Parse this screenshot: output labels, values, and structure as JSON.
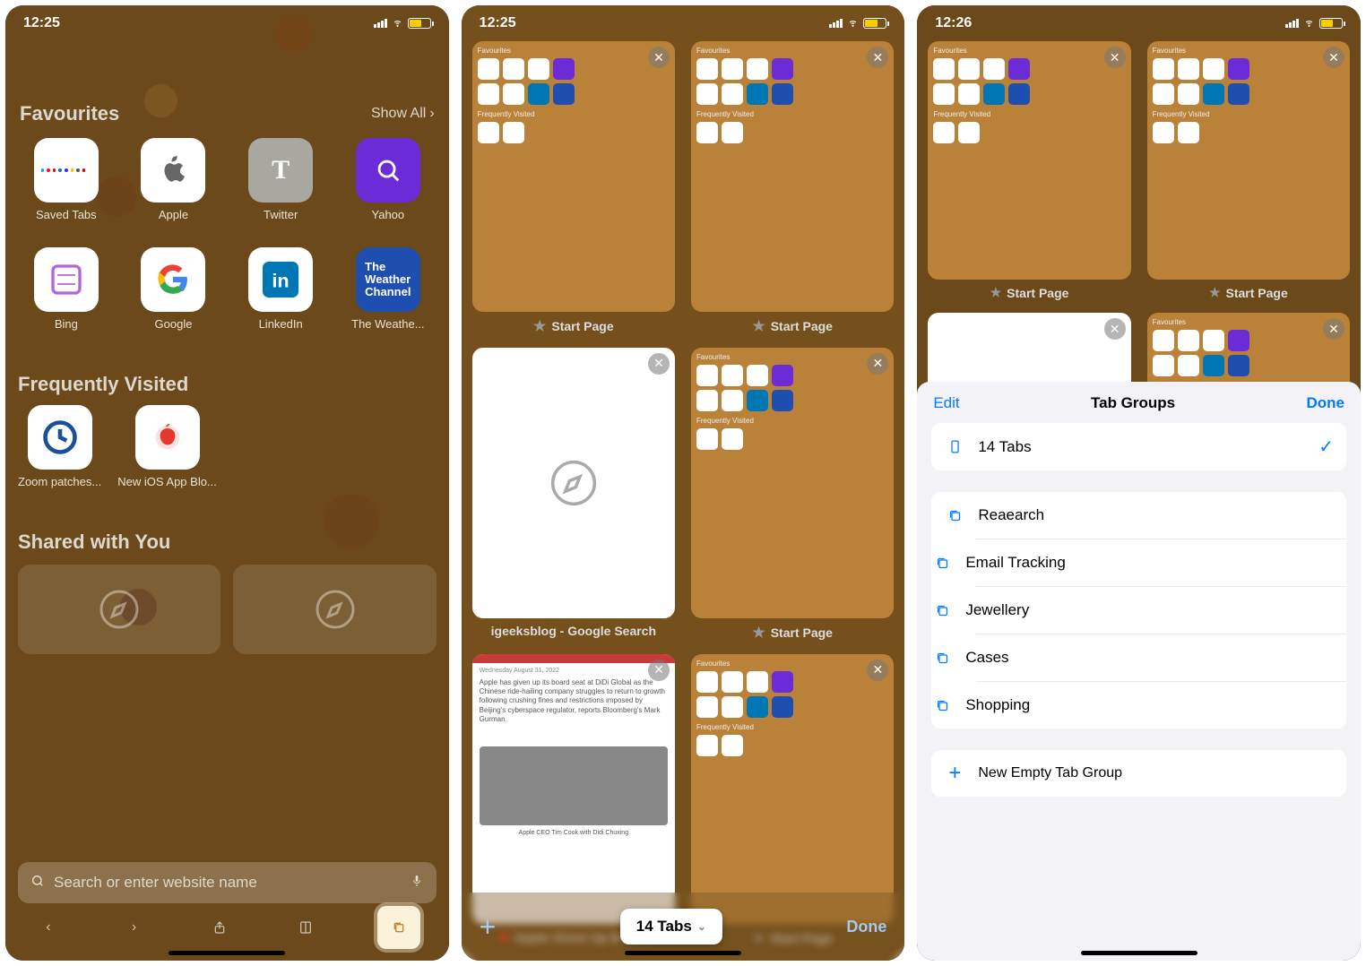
{
  "screen1": {
    "time": "12:25",
    "favourites_title": "Favourites",
    "show_all": "Show All",
    "tiles": [
      {
        "label": "Saved Tabs",
        "bg": "#ffffff"
      },
      {
        "label": "Apple",
        "bg": "#ffffff"
      },
      {
        "label": "Twitter",
        "bg": "#a8a8a0"
      },
      {
        "label": "Yahoo",
        "bg": "#6b2bd6"
      },
      {
        "label": "Bing",
        "bg": "#ffffff"
      },
      {
        "label": "Google",
        "bg": "#ffffff"
      },
      {
        "label": "LinkedIn",
        "bg": "#ffffff"
      },
      {
        "label": "The Weathe...",
        "bg": "#1e4fb0"
      }
    ],
    "freq_title": "Frequently Visited",
    "freq": [
      {
        "label": "Zoom patches..."
      },
      {
        "label": "New iOS App Blo..."
      }
    ],
    "shared_title": "Shared with You",
    "search_placeholder": "Search or enter website name"
  },
  "screen2": {
    "time": "12:25",
    "tabs": [
      {
        "title": "Start Page",
        "kind": "start"
      },
      {
        "title": "Start Page",
        "kind": "start"
      },
      {
        "title": "igeeksblog - Google Search",
        "kind": "compass"
      },
      {
        "title": "Start Page",
        "kind": "start"
      },
      {
        "title": "Apple Gives Up Boar...",
        "kind": "article"
      },
      {
        "title": "Start Page",
        "kind": "start"
      }
    ],
    "tab_count_label": "14 Tabs",
    "done": "Done"
  },
  "screen3": {
    "time": "12:26",
    "tabs": [
      {
        "title": "Start Page",
        "kind": "start"
      },
      {
        "title": "Start Page",
        "kind": "start"
      },
      {
        "title": "",
        "kind": "compass"
      },
      {
        "title": "",
        "kind": "start"
      }
    ],
    "sheet": {
      "edit": "Edit",
      "title": "Tab Groups",
      "done": "Done",
      "current": "14 Tabs",
      "groups": [
        "Reaearch",
        "Email Tracking",
        "Jewellery",
        "Cases",
        "Shopping"
      ],
      "new_label": "New Empty Tab Group"
    }
  }
}
